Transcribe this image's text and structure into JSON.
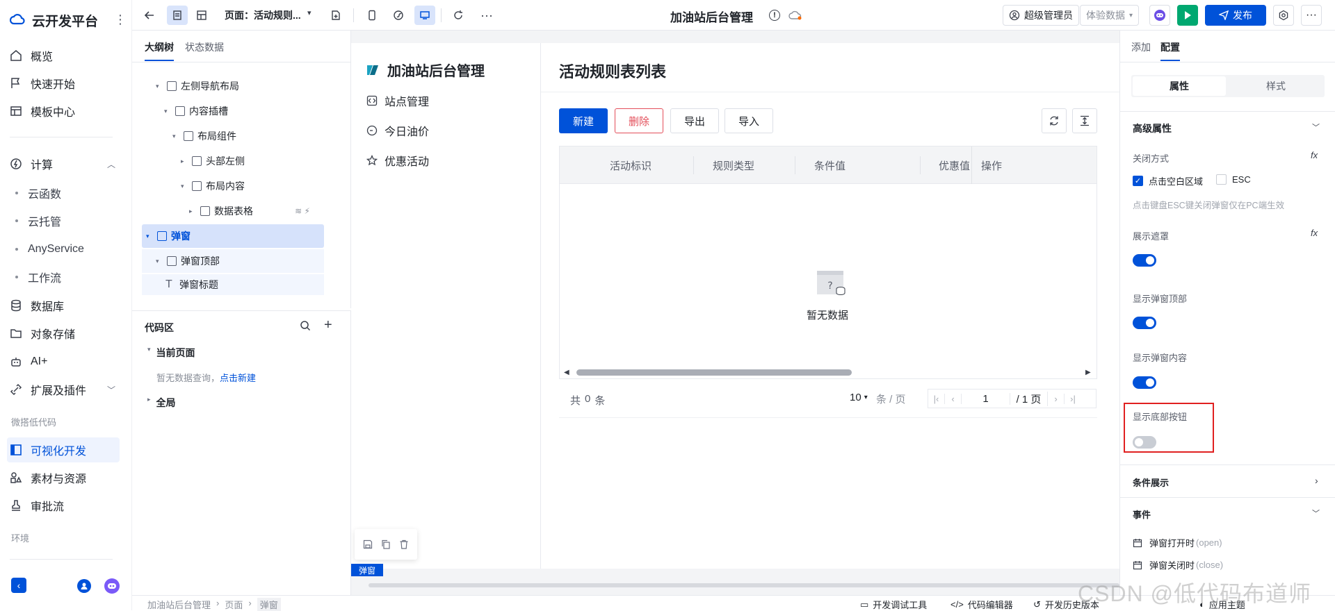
{
  "app": {
    "brand": "云开发平台"
  },
  "nav": {
    "items": [
      {
        "label": "概览"
      },
      {
        "label": "快速开始"
      },
      {
        "label": "模板中心"
      }
    ],
    "compute": {
      "label": "计算",
      "subitems": [
        "云函数",
        "云托管",
        "AnyService",
        "工作流"
      ]
    },
    "items2": [
      {
        "label": "数据库"
      },
      {
        "label": "对象存储"
      },
      {
        "label": "AI+"
      },
      {
        "label": "扩展及插件"
      }
    ],
    "group_lowcode": "微搭低代码",
    "lowcode_items": [
      {
        "label": "可视化开发"
      },
      {
        "label": "素材与资源"
      },
      {
        "label": "审批流"
      }
    ],
    "group_env": "环境"
  },
  "toolbar": {
    "page_label": "页面：活动规则...",
    "app_title": "加油站后台管理",
    "user_label": "超级管理员",
    "data_mode": "体验数据",
    "publish_label": "发布"
  },
  "outline": {
    "tabs": [
      "大纲树",
      "状态数据"
    ],
    "nodes": [
      {
        "label": "左侧导航布局"
      },
      {
        "label": "内容插槽"
      },
      {
        "label": "布局组件"
      },
      {
        "label": "头部左侧"
      },
      {
        "label": "布局内容"
      },
      {
        "label": "数据表格"
      },
      {
        "label": "弹窗"
      },
      {
        "label": "弹窗顶部"
      },
      {
        "label": "弹窗标题"
      }
    ]
  },
  "code": {
    "title": "代码区",
    "current_page": "当前页面",
    "empty_text": "暂无数据查询，",
    "create_link": "点击新建",
    "global": "全局"
  },
  "preview": {
    "app_title": "加油站后台管理",
    "menu": [
      "站点管理",
      "今日油价",
      "优惠活动"
    ],
    "page_title": "活动规则表列表",
    "buttons": {
      "new": "新建",
      "delete": "删除",
      "export": "导出",
      "import": "导入"
    },
    "columns": [
      "活动标识",
      "规则类型",
      "条件值",
      "优惠值",
      "操作"
    ],
    "empty": "暂无数据",
    "pagination": {
      "total_prefix": "共",
      "total": "0",
      "total_suffix": "条",
      "page_size": "10",
      "page_size_unit": "条 / 页",
      "page": "1",
      "page_total": "/ 1 页"
    },
    "selected_tag": "弹窗"
  },
  "right_panel": {
    "tabs": [
      "添加",
      "配置"
    ],
    "subtabs": [
      "属性",
      "样式"
    ],
    "advanced": "高级属性",
    "close_mode": "关闭方式",
    "close_options": [
      "点击空白区域",
      "ESC"
    ],
    "close_hint": "点击键盘ESC键关闭弹窗仅在PC端生效",
    "show_mask": "展示遮罩",
    "show_header": "显示弹窗顶部",
    "show_content": "显示弹窗内容",
    "show_footer": "显示底部按钮",
    "condition": "条件展示",
    "events": "事件",
    "event_items": [
      {
        "label": "弹窗打开时",
        "code": "(open)"
      },
      {
        "label": "弹窗关闭时",
        "code": "(close)"
      }
    ],
    "fx": "fx",
    "highlight_color": "#e02020"
  },
  "statusbar": {
    "breadcrumb": [
      "加油站后台管理",
      "页面",
      "弹窗"
    ],
    "tools": [
      "开发调试工具",
      "代码编辑器",
      "开发历史版本",
      "应用主题"
    ]
  },
  "watermark": "CSDN @低代码布道师"
}
